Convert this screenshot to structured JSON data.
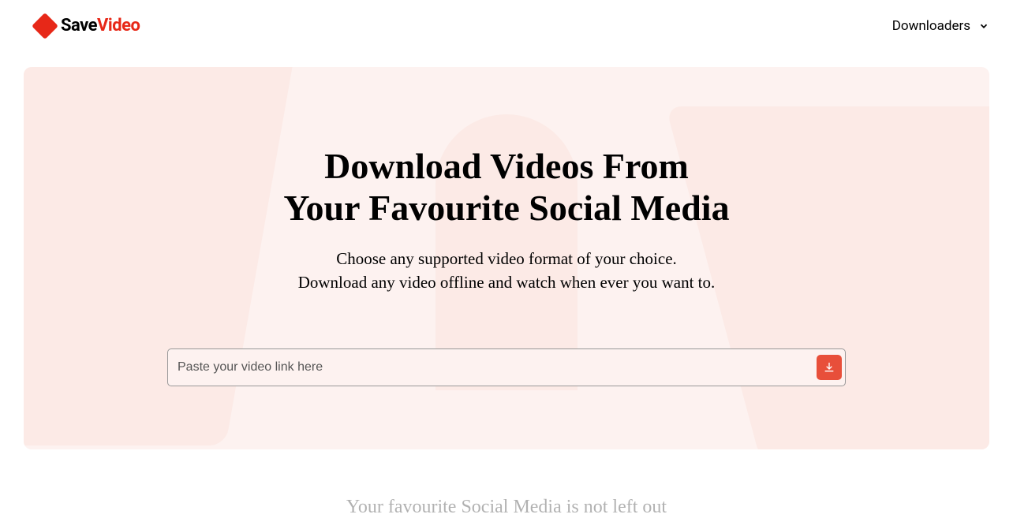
{
  "logo": {
    "save": "Save",
    "video": "Video"
  },
  "nav": {
    "downloaders": "Downloaders"
  },
  "hero": {
    "title_line1": "Download Videos From",
    "title_line2": "Your Favourite Social Media",
    "subtitle_line1": "Choose any supported video format of your choice.",
    "subtitle_line2": "Download any video offline and watch when ever you want to."
  },
  "input": {
    "placeholder": "Paste your video link here",
    "value": ""
  },
  "below": {
    "partial_text": "Your favourite Social Media is not left out"
  }
}
